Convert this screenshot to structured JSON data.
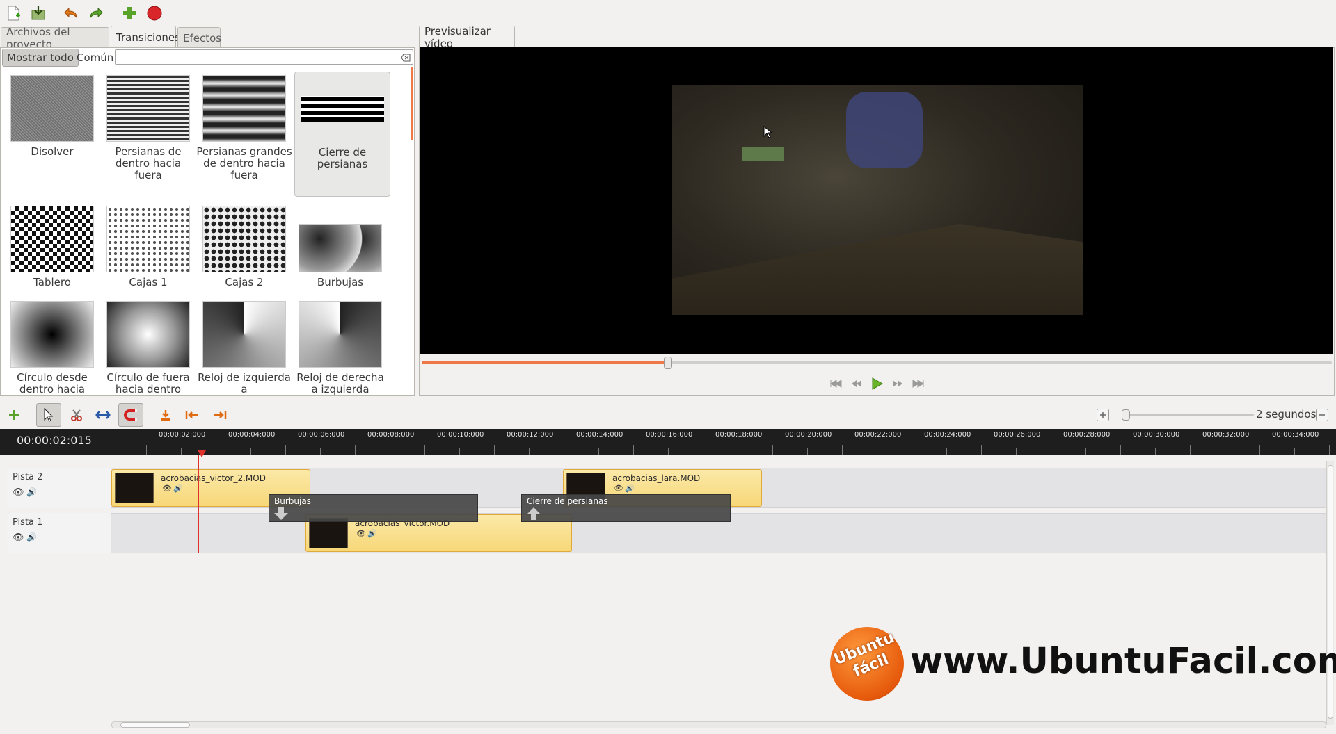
{
  "toolbar": {
    "icons": [
      "new-file-icon",
      "save-icon",
      "undo-icon",
      "redo-icon",
      "add-icon",
      "record-icon"
    ]
  },
  "left_tabs": [
    {
      "label": "Archivos del proyecto"
    },
    {
      "label": "Transiciones"
    },
    {
      "label": "Efectos"
    }
  ],
  "filter": {
    "show_all": "Mostrar todo",
    "common": "Común",
    "search_placeholder": ""
  },
  "transitions": [
    {
      "label": "Disolver"
    },
    {
      "label": "Persianas de dentro hacia fuera"
    },
    {
      "label": "Persianas grandes de dentro hacia fuera"
    },
    {
      "label": "Cierre de persianas"
    },
    {
      "label": "Tablero"
    },
    {
      "label": "Cajas 1"
    },
    {
      "label": "Cajas 2"
    },
    {
      "label": "Burbujas"
    },
    {
      "label": "Círculo desde dentro hacia"
    },
    {
      "label": "Círculo de fuera hacia dentro"
    },
    {
      "label": "Reloj de izquierda a"
    },
    {
      "label": "Reloj de derecha a izquierda"
    }
  ],
  "preview_tab": {
    "label": "Previsualizar vídeo"
  },
  "playback": {
    "progress": 0.27
  },
  "timeline_toolbar": {
    "zoom_label": "2 segundos"
  },
  "timecode": "00:00:02:015",
  "ruler_ticks": [
    "00:00:02:000",
    "00:00:04:000",
    "00:00:06:000",
    "00:00:08:000",
    "00:00:10:000",
    "00:00:12:000",
    "00:00:14:000",
    "00:00:16:000",
    "00:00:18:000",
    "00:00:20:000",
    "00:00:22:000",
    "00:00:24:000",
    "00:00:26:000",
    "00:00:28:000",
    "00:00:30:000",
    "00:00:32:000",
    "00:00:34:000"
  ],
  "tracks": [
    {
      "name": "Pista 2"
    },
    {
      "name": "Pista 1"
    }
  ],
  "clips": {
    "c1": "acrobacias_victor_2.MOD",
    "c2": "acrobacias_lara.MOD",
    "c3": "acrobacias_victor.MOD"
  },
  "transitions_on_timeline": {
    "t1": "Burbujas",
    "t2": "Cierre de persianas"
  },
  "watermark": {
    "logo_line1": "Ubuntu",
    "logo_line2": "fácil",
    "url": "www.UbuntuFacil.com"
  }
}
